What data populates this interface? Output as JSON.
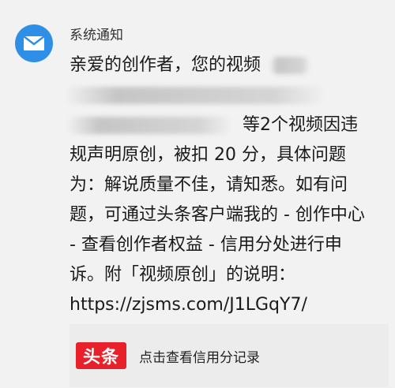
{
  "sender": {
    "name": "系统通知",
    "icon": "mail-icon",
    "icon_bg": "#2f8fe6"
  },
  "message": {
    "line1": "亲爱的创作者，您的视频",
    "line3_suffix": "等2个视频因违",
    "line4": "规声明原创，被扣 20 分，具体问题",
    "line5": "为：解说质量不佳，请知悉。如有问",
    "line6": "题，可通过头条客户端我的 - 创作中心",
    "line7": "- 查看创作者权益 - 信用分处进行申",
    "line8": "诉。附「视频原创」的说明：",
    "link": "https://zjsms.com/J1LGqY7/"
  },
  "card": {
    "logo_text": "头条",
    "logo_color": "#e8202a",
    "label": "点击查看信用分记录"
  }
}
